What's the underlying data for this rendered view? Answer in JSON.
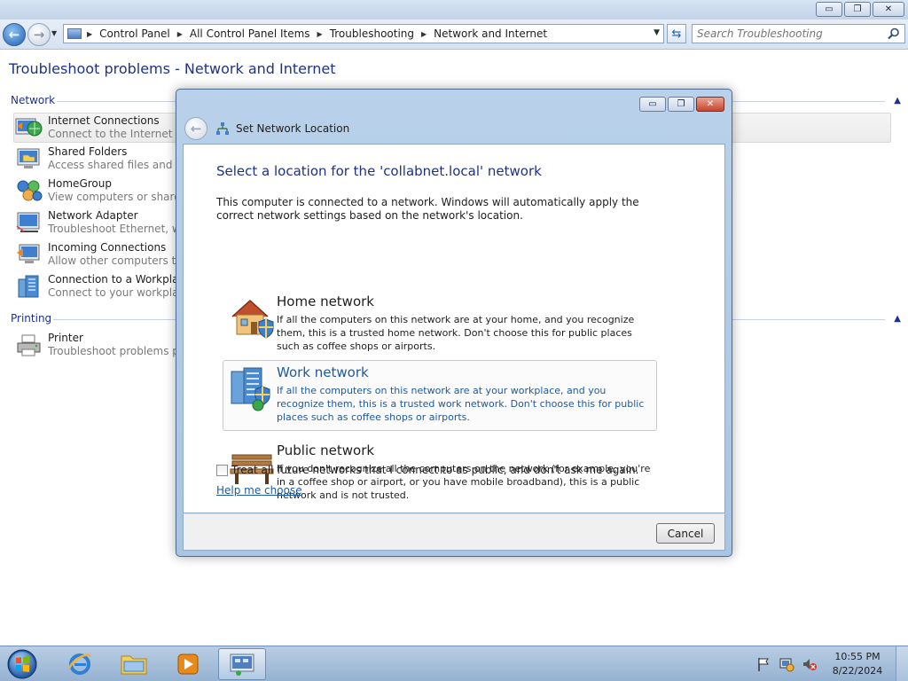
{
  "window": {
    "caption_buttons": {
      "minimize": "▭",
      "maximize": "❐",
      "close": "✕"
    }
  },
  "addressbar": {
    "breadcrumbs": [
      "Control Panel",
      "All Control Panel Items",
      "Troubleshooting",
      "Network and Internet"
    ],
    "search_placeholder": "Search Troubleshooting"
  },
  "page": {
    "title": "Troubleshoot problems - Network and Internet",
    "groups": [
      {
        "name": "Network",
        "items": [
          {
            "title": "Internet Connections",
            "desc": "Connect to the Internet or t",
            "icon": "internet-connections-icon"
          },
          {
            "title": "Shared Folders",
            "desc": "Access shared files and fold",
            "icon": "shared-folders-icon"
          },
          {
            "title": "HomeGroup",
            "desc": "View computers or shared f",
            "icon": "homegroup-icon"
          },
          {
            "title": "Network Adapter",
            "desc": "Troubleshoot Ethernet, wire",
            "icon": "network-adapter-icon"
          },
          {
            "title": "Incoming Connections",
            "desc": "Allow other computers to c",
            "icon": "incoming-connections-icon"
          },
          {
            "title": "Connection to a Workplace",
            "desc": "Connect to your workplace",
            "icon": "workplace-icon"
          }
        ]
      },
      {
        "name": "Printing",
        "items": [
          {
            "title": "Printer",
            "desc": "Troubleshoot problems pre",
            "icon": "printer-icon"
          }
        ]
      }
    ]
  },
  "dialog": {
    "title": "Set Network Location",
    "heading": "Select a location for the 'collabnet.local' network",
    "intro": "This computer is connected to a network. Windows will automatically apply the correct network settings based on the network's location.",
    "options": [
      {
        "title": "Home network",
        "desc": "If all the computers on this network are at your home, and you recognize them, this is a trusted home network.  Don't choose this for public places such as coffee shops or airports."
      },
      {
        "title": "Work network",
        "desc": "If all the computers on this network are at your workplace, and you recognize them, this is a trusted work network.  Don't choose this for public places such as coffee shops or airports."
      },
      {
        "title": "Public network",
        "desc": "If you don't recognize all the computers on the network (for example, you're in a coffee shop or airport, or you have mobile broadband), this is a public network and is not trusted."
      }
    ],
    "checkbox_label": "Treat all future networks that I connect to as public, and don't ask me again.",
    "checkbox_checked": false,
    "help_link": "Help me choose",
    "cancel_label": "Cancel"
  },
  "taskbar": {
    "time": "10:55 PM",
    "date": "8/22/2024"
  }
}
